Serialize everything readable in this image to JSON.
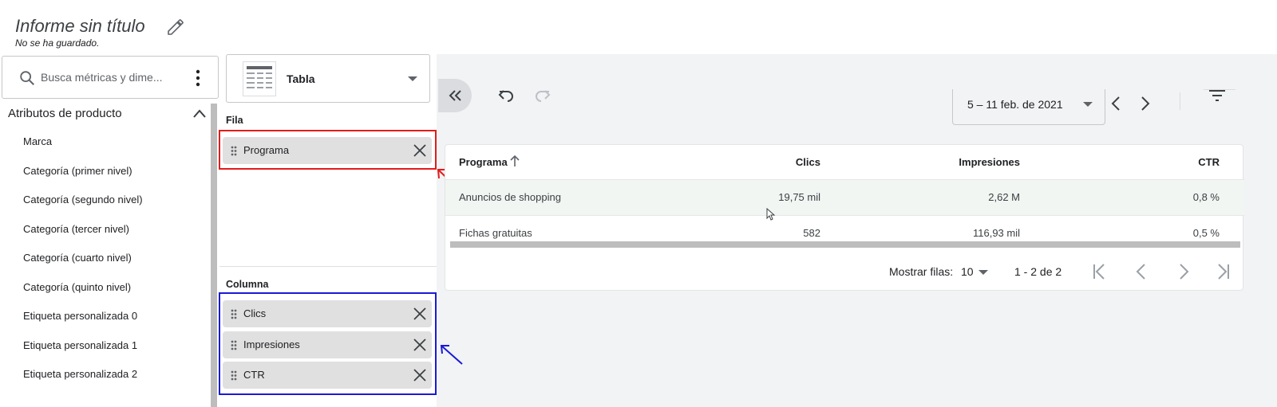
{
  "header": {
    "title": "Informe sin título",
    "save_status": "No se ha guardado."
  },
  "left_panel": {
    "search_placeholder": "Busca métricas y dime...",
    "section_title": "Atributos de producto",
    "items": [
      "Marca",
      "Categoría (primer nivel)",
      "Categoría (segundo nivel)",
      "Categoría (tercer nivel)",
      "Categoría (cuarto nivel)",
      "Categoría (quinto nivel)",
      "Etiqueta personalizada 0",
      "Etiqueta personalizada 1",
      "Etiqueta personalizada 2"
    ]
  },
  "config": {
    "chart_type": "Tabla",
    "row_label": "Fila",
    "row_chips": [
      "Programa"
    ],
    "column_label": "Columna",
    "column_chips": [
      "Clics",
      "Impresiones",
      "CTR"
    ]
  },
  "toolbar": {
    "date_range": "5 – 11 feb. de 2021"
  },
  "table": {
    "headers": [
      "Programa",
      "Clics",
      "Impresiones",
      "CTR"
    ],
    "rows": [
      [
        "Anuncios de shopping",
        "19,75 mil",
        "2,62 M",
        "0,8 %"
      ],
      [
        "Fichas gratuitas",
        "582",
        "116,93 mil",
        "0,5 %"
      ]
    ],
    "rows_label": "Mostrar filas:",
    "rows_per_page": "10",
    "page_range": "1 - 2 de 2"
  },
  "colors": {
    "annotation_red": "#e41b1b",
    "annotation_blue": "#1a1ad6",
    "row_highlight": "#f1f6f3"
  }
}
